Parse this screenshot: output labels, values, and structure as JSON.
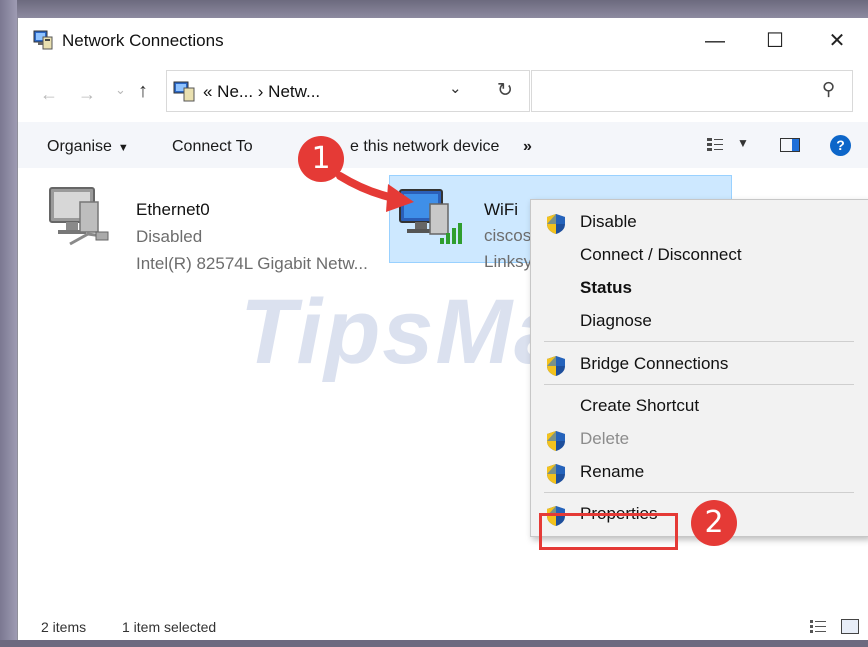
{
  "window": {
    "title": "Network Connections",
    "controls": {
      "minimize": "—",
      "maximize": "☐",
      "close": "✕"
    }
  },
  "address": {
    "back": "←",
    "forward": "→",
    "recent": "⌄",
    "up": "↑",
    "breadcrumb": "«  Ne...  ›  Netw...",
    "dropdown": "⌄",
    "refresh": "↻",
    "search_icon": "⚲"
  },
  "toolbar": {
    "organise": "Organise",
    "connect_to": "Connect To",
    "disable_device": "e this network device",
    "more": "»"
  },
  "items": [
    {
      "name": "Ethernet0",
      "status": "Disabled",
      "device": "Intel(R) 82574L Gigabit Netw..."
    },
    {
      "name": "WiFi",
      "status": "ciscosb1",
      "device": "Linksys"
    }
  ],
  "watermark": "TipsMake",
  "context_menu": {
    "items": [
      {
        "label": "Disable",
        "shield": true,
        "style": "normal"
      },
      {
        "label": "Connect / Disconnect",
        "shield": false,
        "style": "normal"
      },
      {
        "label": "Status",
        "shield": false,
        "style": "bold"
      },
      {
        "label": "Diagnose",
        "shield": false,
        "style": "normal"
      },
      {
        "label": "Bridge Connections",
        "shield": true,
        "style": "normal"
      },
      {
        "label": "Create Shortcut",
        "shield": false,
        "style": "normal"
      },
      {
        "label": "Delete",
        "shield": true,
        "style": "disabled"
      },
      {
        "label": "Rename",
        "shield": true,
        "style": "normal"
      },
      {
        "label": "Properties",
        "shield": true,
        "style": "normal"
      }
    ]
  },
  "callouts": {
    "step1": "1",
    "step2": "2"
  },
  "status": {
    "count": "2 items",
    "selected": "1 item selected"
  },
  "colors": {
    "accent": "#0d66c9",
    "selection": "#cde8ff",
    "callout": "#e53a36"
  }
}
